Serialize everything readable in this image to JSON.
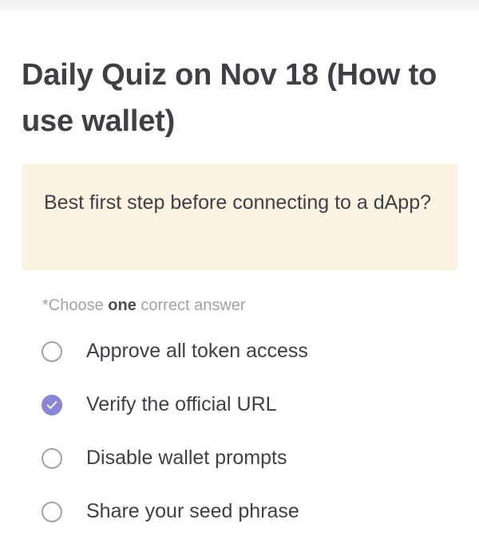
{
  "quiz": {
    "title": "Daily Quiz on Nov 18 (How to use wallet)",
    "question": "Best first step before connecting to a dApp?",
    "hint": {
      "prefix": "*Choose ",
      "emphasis": "one",
      "suffix": " correct answer"
    },
    "options": [
      {
        "label": "Approve all token access",
        "selected": false
      },
      {
        "label": "Verify the official URL",
        "selected": true
      },
      {
        "label": "Disable wallet prompts",
        "selected": false
      },
      {
        "label": "Share your seed phrase",
        "selected": false
      }
    ],
    "colors": {
      "accent": "#8b85d6",
      "question_bg": "#fdf3e2",
      "text": "#3f3f46",
      "muted": "#a1a1aa"
    },
    "icons": {
      "selected": "check-icon"
    }
  }
}
